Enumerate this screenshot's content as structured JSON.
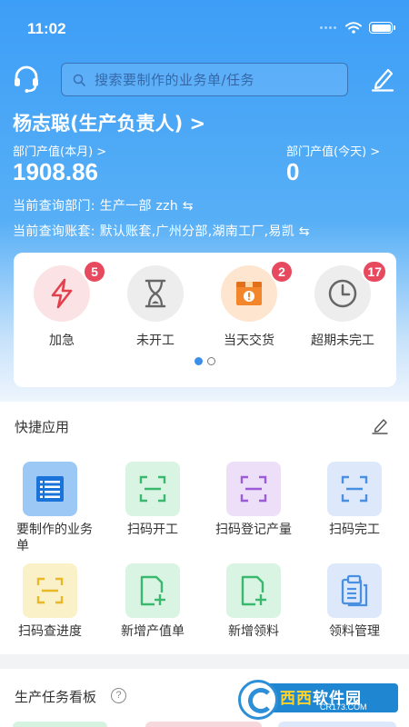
{
  "status": {
    "time": "11:02"
  },
  "search": {
    "placeholder": "搜索要制作的业务单/任务"
  },
  "user": {
    "name": "杨志聪(生产负责人) >"
  },
  "stats": {
    "month_label": "部门产值(本月) >",
    "month_value": "1908.86",
    "today_label": "部门产值(今天) >",
    "today_value": "0"
  },
  "query": {
    "dept": "当前查询部门: 生产一部 zzh ⇆",
    "account": "当前查询账套: 默认账套,广州分部,湖南工厂,易凯 ⇆"
  },
  "quick": [
    {
      "label": "加急",
      "badge": "5",
      "icon": "lightning-icon"
    },
    {
      "label": "未开工",
      "badge": "",
      "icon": "hourglass-icon"
    },
    {
      "label": "当天交货",
      "badge": "2",
      "icon": "delivery-box-icon"
    },
    {
      "label": "超期未完工",
      "badge": "17",
      "icon": "clock-icon"
    }
  ],
  "pager": {
    "pages": 2,
    "active": 0
  },
  "apps_section": {
    "title": "快捷应用"
  },
  "apps": [
    {
      "label": "要制作的业务单",
      "icon": "list-icon"
    },
    {
      "label": "扫码开工",
      "icon": "scan-icon"
    },
    {
      "label": "扫码登记产量",
      "icon": "scan-icon"
    },
    {
      "label": "扫码完工",
      "icon": "scan-icon"
    },
    {
      "label": "扫码查进度",
      "icon": "scan-icon"
    },
    {
      "label": "新增产值单",
      "icon": "add-document-icon"
    },
    {
      "label": "新增领料",
      "icon": "add-document-icon"
    },
    {
      "label": "领料管理",
      "icon": "clipboard-icon"
    }
  ],
  "board": {
    "title": "生产任务看板",
    "help": "?"
  },
  "watermark": {
    "text_a": "西西",
    "text_b": "软件园",
    "domain": "CR173.COM"
  },
  "colors": {
    "accent": "#3d9ef7",
    "badge": "#e74a5e",
    "urgent_red": "#e2404c",
    "delivery_orange": "#f3862a",
    "list_blue": "#1a73d9",
    "scan_green": "#3ab96e",
    "scan_purple": "#9c5cd8",
    "scan_blue": "#4a90e2",
    "scan_yellow": "#e8b826"
  }
}
